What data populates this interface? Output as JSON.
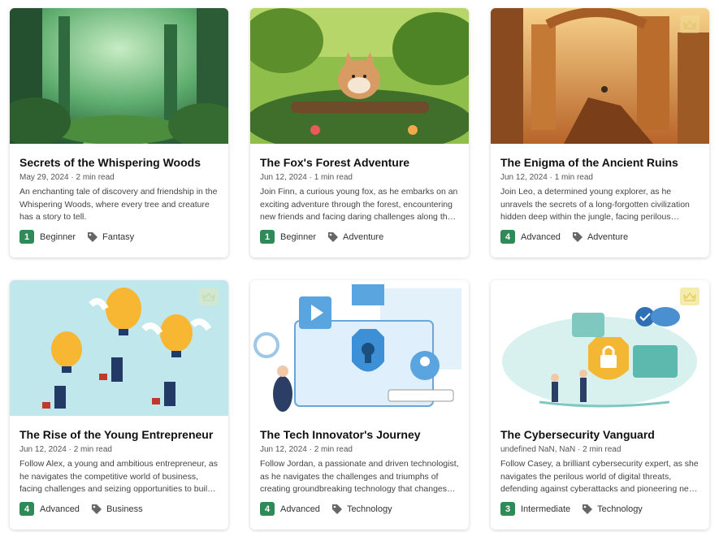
{
  "cards": [
    {
      "title": "Secrets of the Whispering Woods",
      "meta": "May 29, 2024 · 2 min read",
      "description": "An enchanting tale of discovery and friendship in the Whispering Woods, where every tree and creature has a story to tell.",
      "level_number": "1",
      "level": "Beginner",
      "genre": "Fantasy",
      "premium": false
    },
    {
      "title": "The Fox's Forest Adventure",
      "meta": "Jun 12, 2024 · 1 min read",
      "description": "Join Finn, a curious young fox, as he embarks on an exciting adventure through the forest, encountering new friends and facing daring challenges along the way.",
      "level_number": "1",
      "level": "Beginner",
      "genre": "Adventure",
      "premium": false
    },
    {
      "title": "The Enigma of the Ancient Ruins",
      "meta": "Jun 12, 2024 · 1 min read",
      "description": "Join Leo, a determined young explorer, as he unravels the secrets of a long-forgotten civilization hidden deep within the jungle, facing perilous challenges.",
      "level_number": "4",
      "level": "Advanced",
      "genre": "Adventure",
      "premium": true
    },
    {
      "title": "The Rise of the Young Entrepreneur",
      "meta": "Jun 12, 2024 · 2 min read",
      "description": "Follow Alex, a young and ambitious entrepreneur, as he navigates the competitive world of business, facing challenges and seizing opportunities to build his empire.",
      "level_number": "4",
      "level": "Advanced",
      "genre": "Business",
      "premium": true
    },
    {
      "title": "The Tech Innovator's Journey",
      "meta": "Jun 12, 2024 · 2 min read",
      "description": "Follow Jordan, a passionate and driven technologist, as he navigates the challenges and triumphs of creating groundbreaking technology that changes the world.",
      "level_number": "4",
      "level": "Advanced",
      "genre": "Technology",
      "premium": false
    },
    {
      "title": "The Cybersecurity Vanguard",
      "meta": "undefined NaN, NaN · 2 min read",
      "description": "Follow Casey, a brilliant cybersecurity expert, as she navigates the perilous world of digital threats, defending against cyberattacks and pioneering new defenses.",
      "level_number": "3",
      "level": "Intermediate",
      "genre": "Technology",
      "premium": true
    }
  ],
  "colors": {
    "level_badge": "#2e8b57",
    "crown_bg": "#f2e9a0",
    "crown_fg": "#e2c84a"
  }
}
